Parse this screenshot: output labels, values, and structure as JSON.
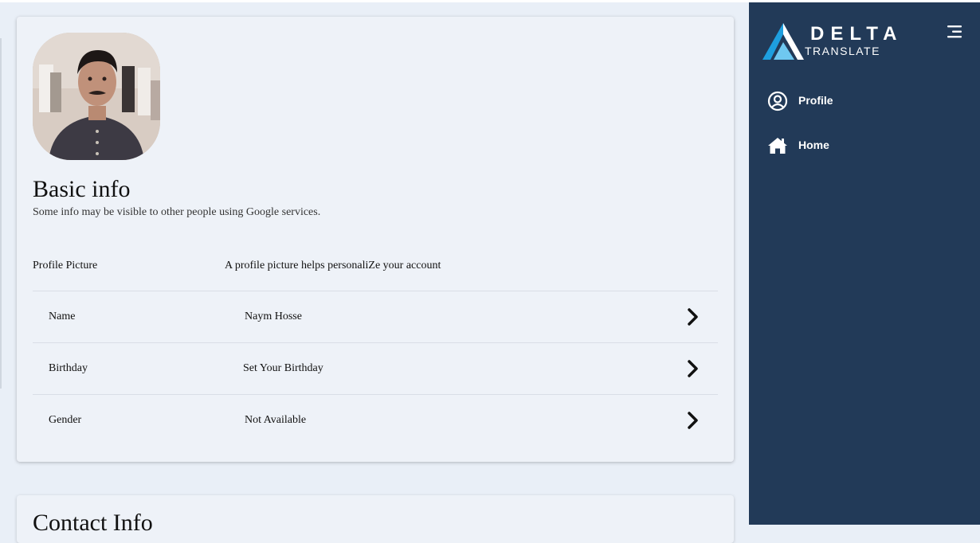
{
  "profile": {
    "section_title": "Basic info",
    "section_subtitle": "Some info may be visible to other people using Google services.",
    "picture_row": {
      "label": "Profile Picture",
      "description": "A profile picture helps personaliZe your account"
    },
    "rows": [
      {
        "label": "Name",
        "value": "Naym Hosse"
      },
      {
        "label": "Birthday",
        "value": "Set Your Birthday"
      },
      {
        "label": "Gender",
        "value": "Not Available"
      }
    ]
  },
  "contact": {
    "section_title": "Contact Info"
  },
  "sidebar": {
    "brand_name": "DELTA",
    "brand_sub": "TRANSLATE",
    "menu_icon": "hamburger-menu-icon",
    "items": [
      {
        "label": "Profile",
        "icon": "user-circle-icon"
      },
      {
        "label": "Home",
        "icon": "home-icon"
      }
    ]
  },
  "colors": {
    "sidebar_bg": "#223a58",
    "page_bg": "#e9eff7",
    "card_bg": "#eef2f8",
    "logo_accent": "#1e9fdf"
  }
}
